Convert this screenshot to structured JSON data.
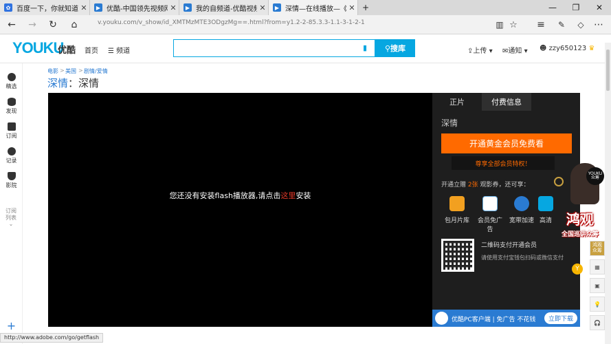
{
  "tabs": [
    {
      "title": "百度一下，你就知道",
      "active": false
    },
    {
      "title": "优酷-中国领先视频网站,提供",
      "active": false
    },
    {
      "title": "我的自频道-优酷视频",
      "active": false
    },
    {
      "title": "深情—在线播放—《深",
      "active": true
    }
  ],
  "window": {
    "minimize": "—",
    "restore": "❐",
    "close": "✕",
    "new_tab": "+"
  },
  "address": {
    "url": "v.youku.com/v_show/id_XMTMzMTE3ODgzMg==.html?from=y1.2-2-85.3.3-1.1-3-1-2-1"
  },
  "header": {
    "logo": "YOUKU",
    "logo_cn": "优酷",
    "nav_home": "首页",
    "nav_channel": "频道",
    "search_placeholder": "",
    "search_button": "搜库",
    "upload": "上传",
    "notify": "通知",
    "username": "zzy650123"
  },
  "leftbar": [
    {
      "label": "精选"
    },
    {
      "label": "发现"
    },
    {
      "label": "订阅"
    },
    {
      "label": "记录"
    },
    {
      "label": "影院"
    },
    {
      "label": "订阅列表"
    }
  ],
  "breadcrumb": [
    "电影",
    "美国",
    "剧情/爱情"
  ],
  "title": {
    "prefix": "深情",
    "sep": "：",
    "name": "深情"
  },
  "player": {
    "message_pre": "您还没有安装flash播放器,请点击",
    "message_link": "这里",
    "message_post": "安装"
  },
  "panel": {
    "tab_main": "正片",
    "tab_pay": "付费信息",
    "name": "深情",
    "vip_button": "开通黄金会员免费看",
    "vip_sub": "尊享全部会员特权！",
    "gift_pre": "开通立赠 ",
    "gift_count": "2张",
    "gift_post": " 观影券，还可享：",
    "perks": [
      "包月片库",
      "会员免广告",
      "宽带加速",
      "高清"
    ],
    "qr_title": "二维码支付开通会员",
    "qr_desc": "请使用支付宝钱包扫码或微信支付"
  },
  "promo": {
    "badge": "YOUKU 众筹",
    "title": "鸿观",
    "subtitle": "全国巡讲众筹"
  },
  "floating": {
    "hongguan": "鸿观众筹",
    "y_badge": "Y"
  },
  "client_bar": {
    "text": "优酷PC客户端 | 免广告 不花钱",
    "download": "立即下载"
  },
  "status_url": "http://www.adobe.com/go/getflash"
}
